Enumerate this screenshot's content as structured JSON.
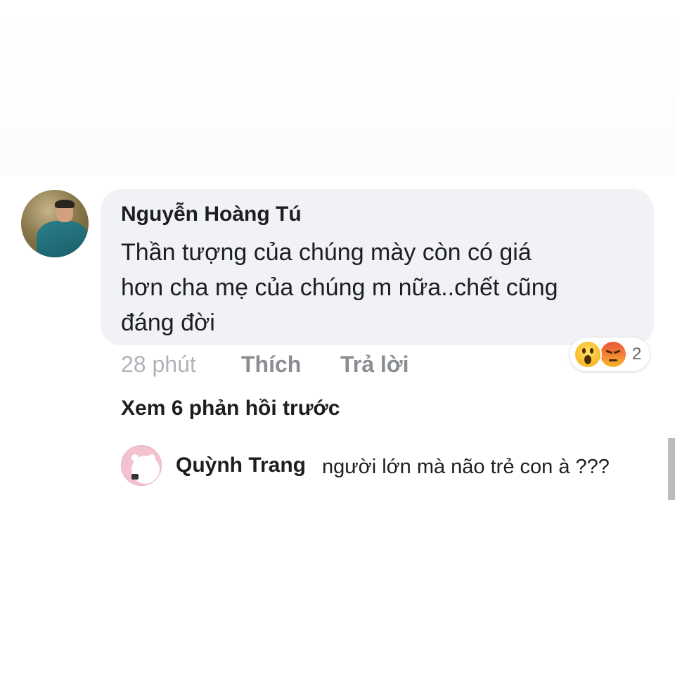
{
  "comment": {
    "author": "Nguyễn Hoàng Tú",
    "text_lines": [
      "Thần tượng của chúng mày còn có giá",
      "hơn cha mẹ của chúng m nữa..chết cũng",
      "đáng đời"
    ],
    "time": "28 phút",
    "like_label": "Thích",
    "reply_label": "Trả lời",
    "reactions": {
      "icons": [
        "wow-emoji-icon",
        "angry-emoji-icon"
      ],
      "count": "2"
    }
  },
  "view_previous_replies": "Xem 6 phản hồi trước",
  "reply": {
    "author": "Quỳnh Trang",
    "text": "người lớn mà não trẻ con à ???"
  },
  "colors": {
    "bubble": "#f0f2f5",
    "meta_time": "#b0b3b8",
    "meta_action": "#8a8d91",
    "wow_emoji": "#f7b928",
    "angry_emoji": "#e9573d",
    "reply_avatar_bg": "#f4c2cf"
  }
}
